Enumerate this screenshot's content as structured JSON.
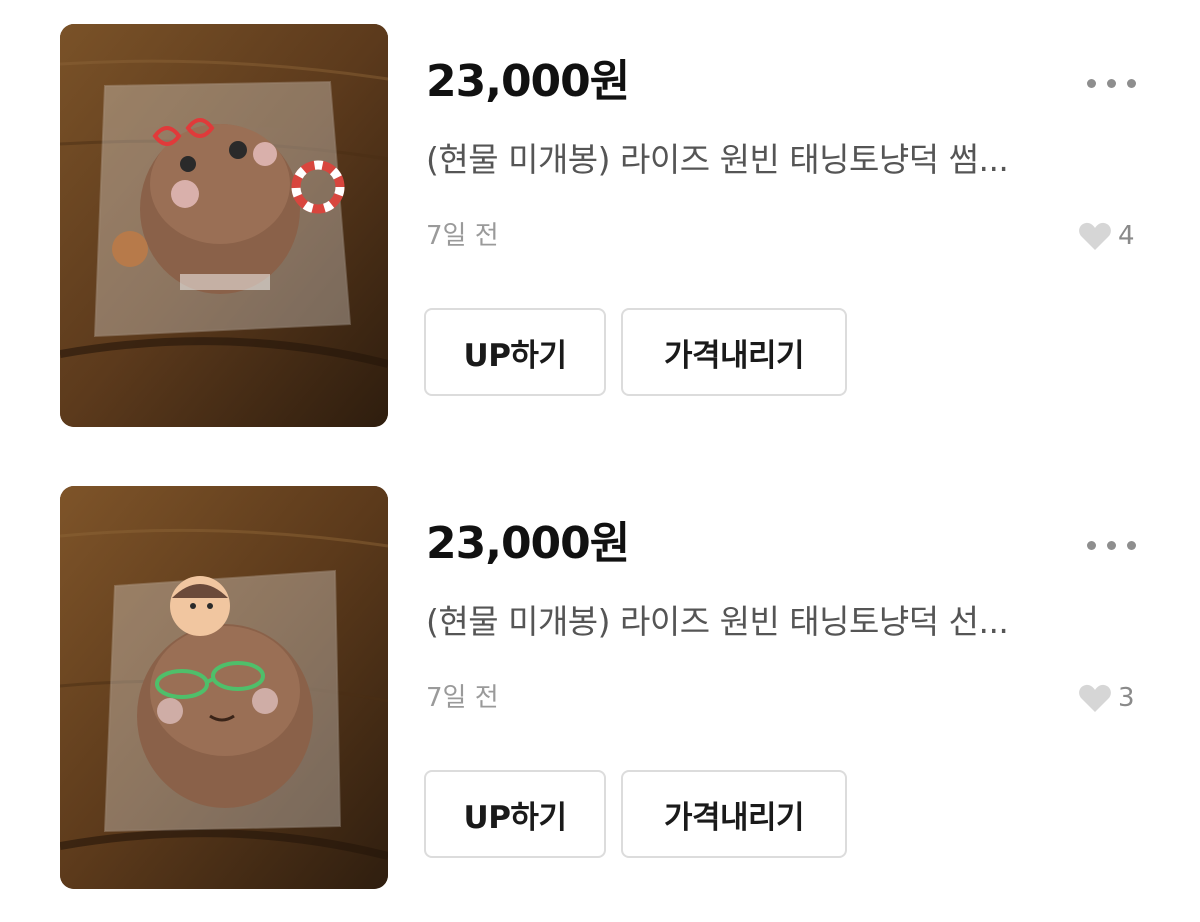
{
  "listings": [
    {
      "price": "23,000원",
      "title": "(현물 미개봉) 라이즈 원빈 태닝토냥덕 썸...",
      "time": "7일 전",
      "likes": "4",
      "up_label": "UP하기",
      "price_down_label": "가격내리기",
      "more_icon": "more-horizontal-icon",
      "heart_icon": "heart-icon"
    },
    {
      "price": "23,000원",
      "title": "(현물 미개봉) 라이즈 원빈 태닝토냥덕 선...",
      "time": "7일 전",
      "likes": "3",
      "up_label": "UP하기",
      "price_down_label": "가격내리기",
      "more_icon": "more-horizontal-icon",
      "heart_icon": "heart-icon"
    }
  ],
  "colors": {
    "price_text": "#111111",
    "title_text": "#555555",
    "meta_text": "#9a9a9a",
    "heart": "#d6d6d6",
    "button_border": "#dcdcdc"
  }
}
